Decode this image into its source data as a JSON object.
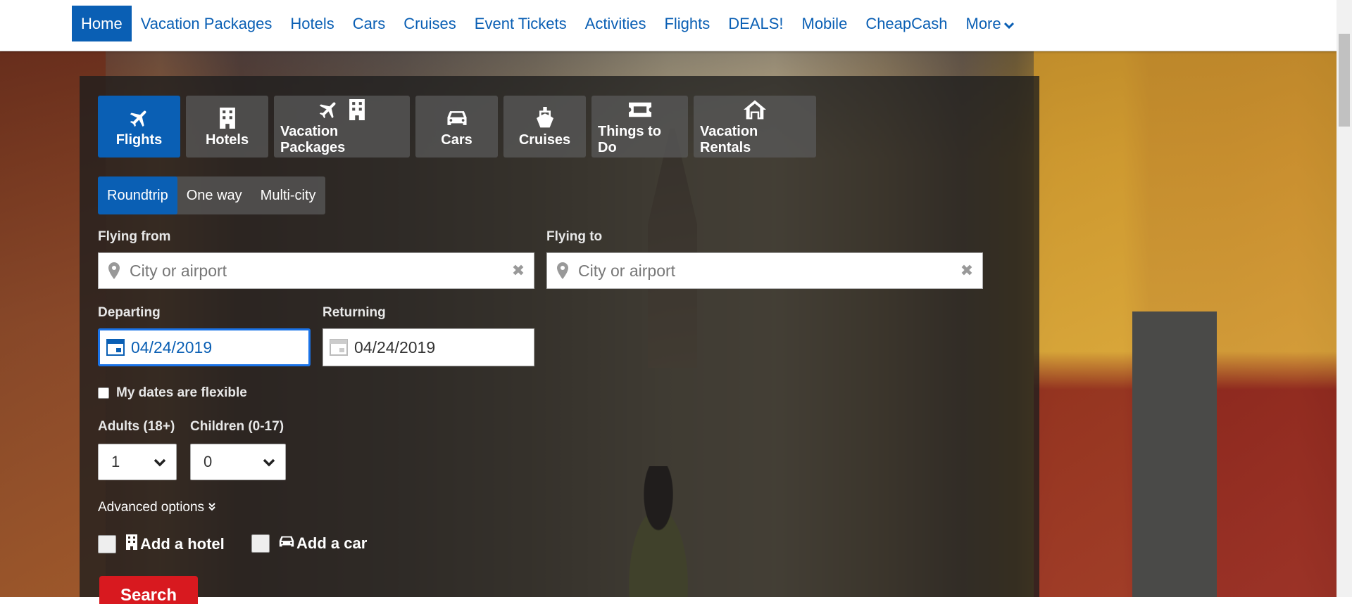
{
  "topnav": {
    "items": [
      "Home",
      "Vacation Packages",
      "Hotels",
      "Cars",
      "Cruises",
      "Event Tickets",
      "Activities",
      "Flights",
      "DEALS!",
      "Mobile",
      "CheapCash",
      "More"
    ],
    "active": "Home"
  },
  "tabs": [
    {
      "label": "Flights",
      "icon": "plane-icon"
    },
    {
      "label": "Hotels",
      "icon": "building-icon"
    },
    {
      "label": "Vacation Packages",
      "icon": "plane-building-icon"
    },
    {
      "label": "Cars",
      "icon": "car-icon"
    },
    {
      "label": "Cruises",
      "icon": "ship-icon"
    },
    {
      "label": "Things to Do",
      "icon": "ticket-icon"
    },
    {
      "label": "Vacation Rentals",
      "icon": "home-icon"
    }
  ],
  "trip_type": {
    "options": [
      "Roundtrip",
      "One way",
      "Multi-city"
    ],
    "selected": "Roundtrip"
  },
  "flying_from": {
    "label": "Flying from",
    "placeholder": "City or airport",
    "value": ""
  },
  "flying_to": {
    "label": "Flying to",
    "placeholder": "City or airport",
    "value": ""
  },
  "departing": {
    "label": "Departing",
    "value": "04/24/2019"
  },
  "returning": {
    "label": "Returning",
    "value": "04/24/2019"
  },
  "flexible": {
    "label": "My dates are flexible",
    "checked": false
  },
  "adults": {
    "label": "Adults (18+)",
    "value": "1"
  },
  "children": {
    "label": "Children (0-17)",
    "value": "0"
  },
  "advanced_options": "Advanced options",
  "add_hotel": {
    "label": "Add a hotel",
    "checked": false
  },
  "add_car": {
    "label": "Add a car",
    "checked": false
  },
  "search_button": "Search",
  "colors": {
    "brand_blue": "#0a5fb4",
    "search_red": "#d8191f",
    "focus_blue": "#1a73e8"
  }
}
